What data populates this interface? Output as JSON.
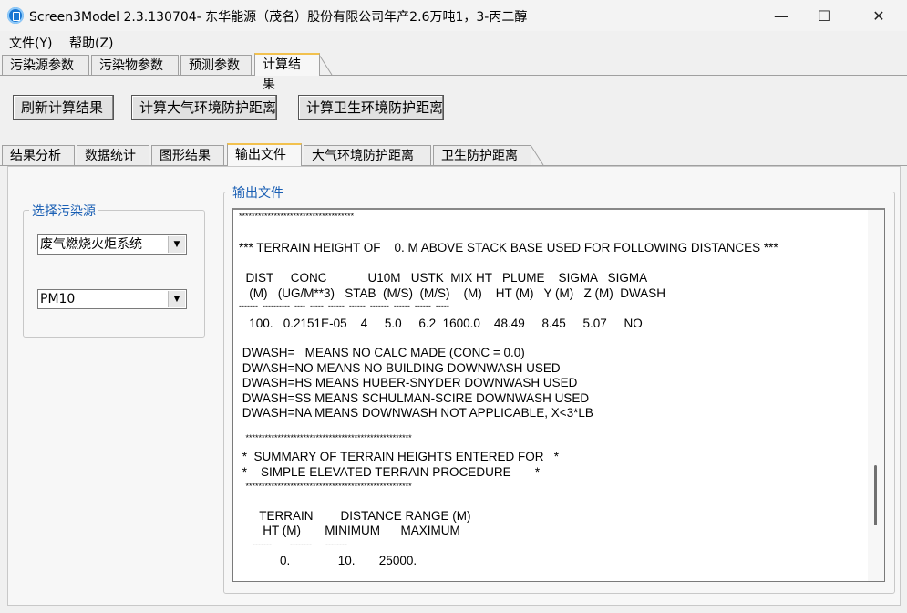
{
  "window": {
    "title": "Screen3Model 2.3.130704- 东华能源（茂名）股份有限公司年产2.6万吨1，3-丙二醇",
    "minimize": "—",
    "maximize": "☐",
    "close": "✕"
  },
  "menu": {
    "file": "文件(Y)",
    "help": "帮助(Z)"
  },
  "top_tabs": [
    "污染源参数",
    "污染物参数",
    "预测参数",
    "计算结果"
  ],
  "buttons": {
    "refresh": "刷新计算结果",
    "atmos_distance": "计算大气环境防护距离",
    "health_distance": "计算卫生环境防护距离"
  },
  "sub_tabs": [
    "结果分析",
    "数据统计",
    "图形结果",
    "输出文件",
    "大气环境防护距离",
    "卫生防护距离"
  ],
  "source_group": {
    "legend": "选择污染源",
    "source_value": "废气燃烧火炬系统",
    "pollutant_value": "PM10"
  },
  "output_group": {
    "legend": "输出文件",
    "lines": [
      "************************************",
      "*** TERRAIN HEIGHT OF    0. M ABOVE STACK BASE USED FOR FOLLOWING DISTANCES ***",
      "  DIST     CONC            U10M   USTK  MIX HT   PLUME    SIGMA   SIGMA",
      "   (M)   (UG/M**3)   STAB  (M/S)  (M/S)    (M)    HT (M)   Y (M)   Z (M)  DWASH",
      "-------  ----------  ----  -----  ------  ------  -------  ------  ------  -----",
      "   100.   0.2151E-05    4     5.0     6.2  1600.0    48.49     8.45     5.07     NO",
      " DWASH=   MEANS NO CALC MADE (CONC = 0.0)",
      " DWASH=NO MEANS NO BUILDING DOWNWASH USED",
      " DWASH=HS MEANS HUBER-SNYDER DOWNWASH USED",
      " DWASH=SS MEANS SCHULMAN-SCIRE DOWNWASH USED",
      " DWASH=NA MEANS DOWNWASH NOT APPLICABLE, X<3*LB",
      "   ****************************************************",
      " *  SUMMARY OF TERRAIN HEIGHTS ENTERED FOR   *",
      " *    SIMPLE ELEVATED TERRAIN PROCEDURE       *",
      "   ****************************************************",
      "      TERRAIN        DISTANCE RANGE (M)",
      "       HT (M)       MINIMUM      MAXIMUM",
      "      -------        --------      --------",
      "            0.              10.       25000."
    ]
  }
}
